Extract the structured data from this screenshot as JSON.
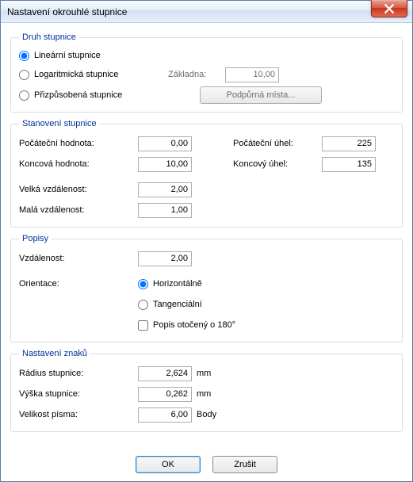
{
  "window": {
    "title": "Nastavení okrouhlé stupnice"
  },
  "scaleType": {
    "legend": "Druh stupnice",
    "linear": "Lineární stupnice",
    "log": "Logaritmická stupnice",
    "custom": "Přizpůsobená stupnice",
    "baseLabel": "Základna:",
    "baseValue": "10,00",
    "supportBtn": "Podpůrná místa..."
  },
  "definition": {
    "legend": "Stanovení stupnice",
    "startVal": "Počáteční hodnota:",
    "startValV": "0,00",
    "endVal": "Koncová hodnota:",
    "endValV": "10,00",
    "startAng": "Počáteční úhel:",
    "startAngV": "225",
    "endAng": "Koncový úhel:",
    "endAngV": "135",
    "bigDist": "Velká vzdálenost:",
    "bigDistV": "2,00",
    "smallDist": "Malá vzdálenost:",
    "smallDistV": "1,00"
  },
  "labels": {
    "legend": "Popisy",
    "dist": "Vzdálenost:",
    "distV": "2,00",
    "orient": "Orientace:",
    "horiz": "Horizontálně",
    "tang": "Tangenciální",
    "rot180": "Popis otočený o 180°"
  },
  "appearance": {
    "legend": "Nastavení znaků",
    "radius": "Rádius stupnice:",
    "radiusV": "2,624",
    "radiusU": "mm",
    "height": "Výška stupnice:",
    "heightV": "0,262",
    "heightU": "mm",
    "font": "Velikost písma:",
    "fontV": "6,00",
    "fontU": "Body"
  },
  "buttons": {
    "ok": "OK",
    "cancel": "Zrušit"
  }
}
